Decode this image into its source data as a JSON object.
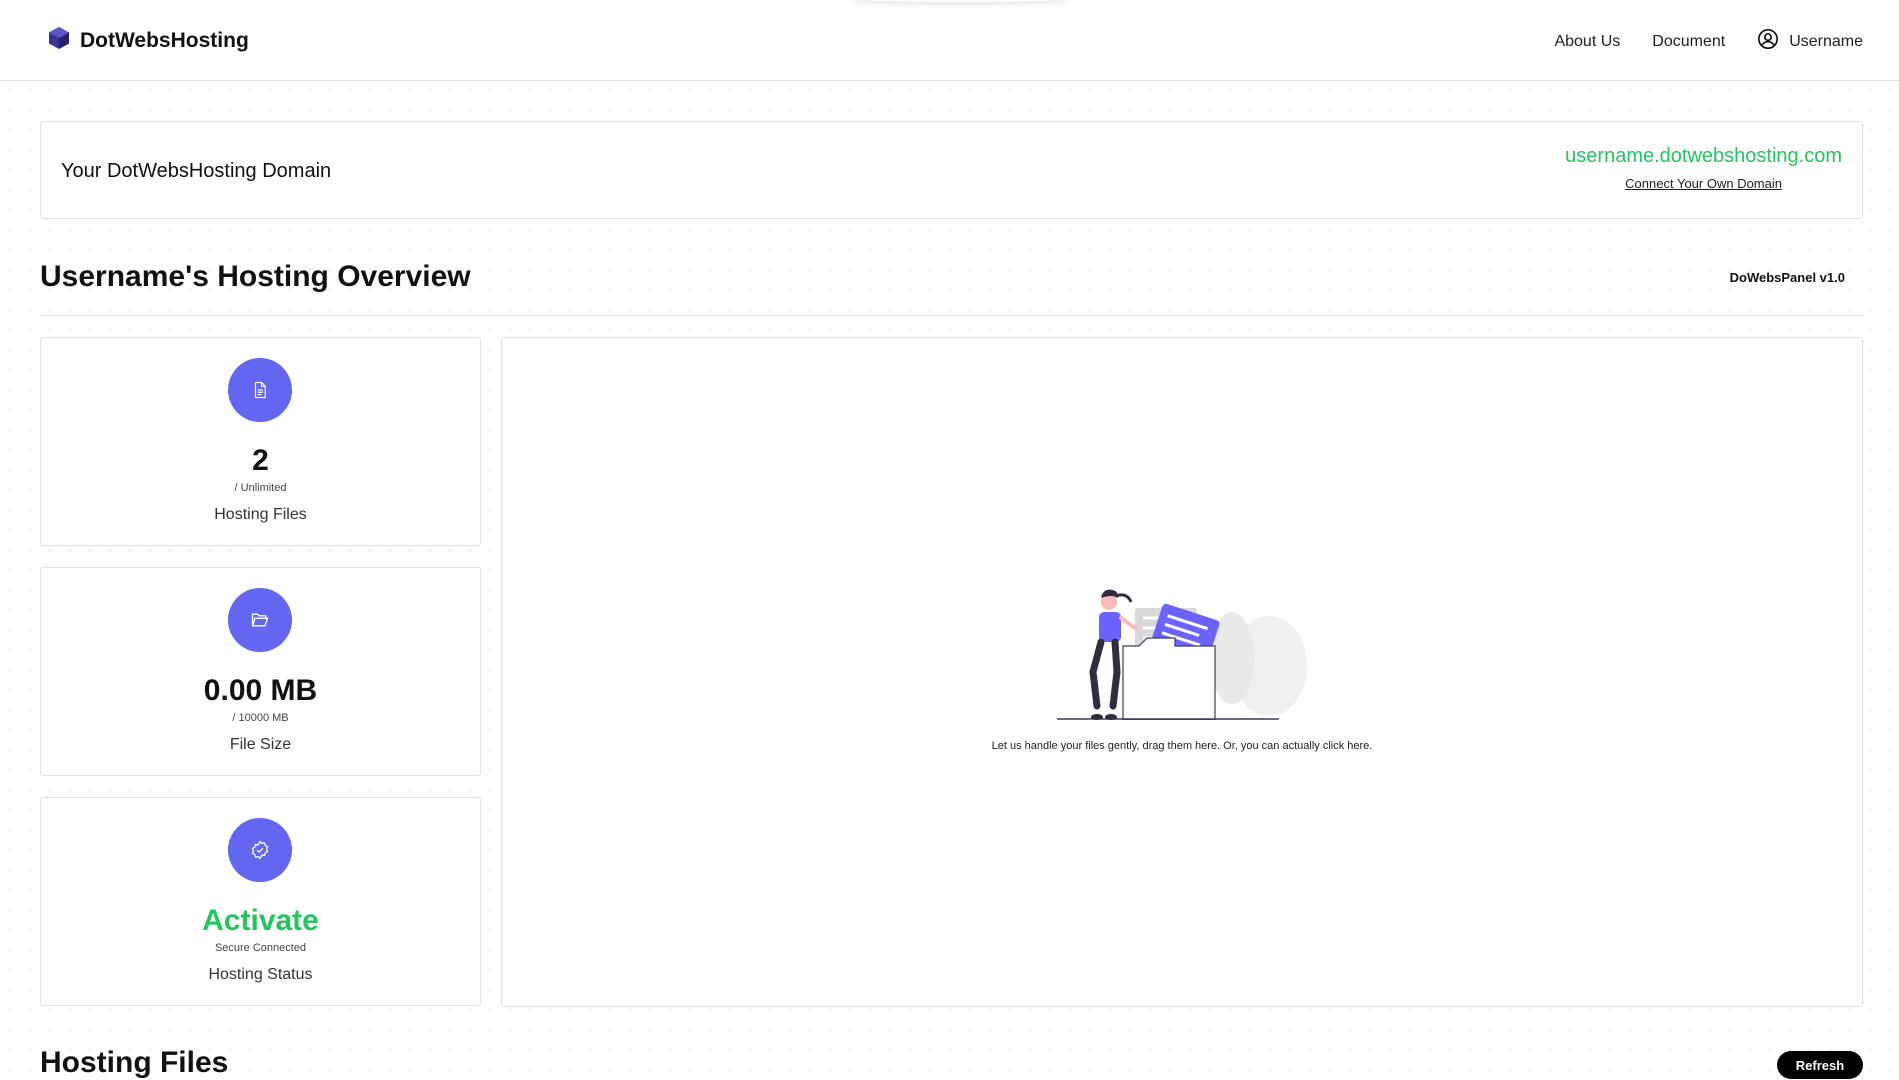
{
  "header": {
    "brand": "DotWebsHosting",
    "nav": [
      "About Us",
      "Document"
    ],
    "username": "Username"
  },
  "domain": {
    "label": "Your DotWebsHosting Domain",
    "url": "username.dotwebshosting.com",
    "connect_link": "Connect Your Own Domain"
  },
  "overview": {
    "title": "Username's Hosting Overview",
    "version": "DoWebsPanel v1.0"
  },
  "stats": [
    {
      "icon": "document-icon",
      "value": "2",
      "sub": "/ Unlimited",
      "label": "Hosting Files"
    },
    {
      "icon": "folder-open-icon",
      "value": "0.00 MB",
      "sub": "/ 10000 MB",
      "label": "File Size"
    },
    {
      "icon": "verified-badge-icon",
      "value": "Activate",
      "sub": "Secure Connected",
      "label": "Hosting Status"
    }
  ],
  "dropzone": {
    "text": "Let us handle your files gently, drag them here. Or, you can actually click here."
  },
  "files": {
    "title": "Hosting Files",
    "refresh_label": "Refresh"
  },
  "colors": {
    "accent": "#6366f1",
    "brand_logo": "#3b3490",
    "success": "#22c55e",
    "button": "#000000"
  }
}
